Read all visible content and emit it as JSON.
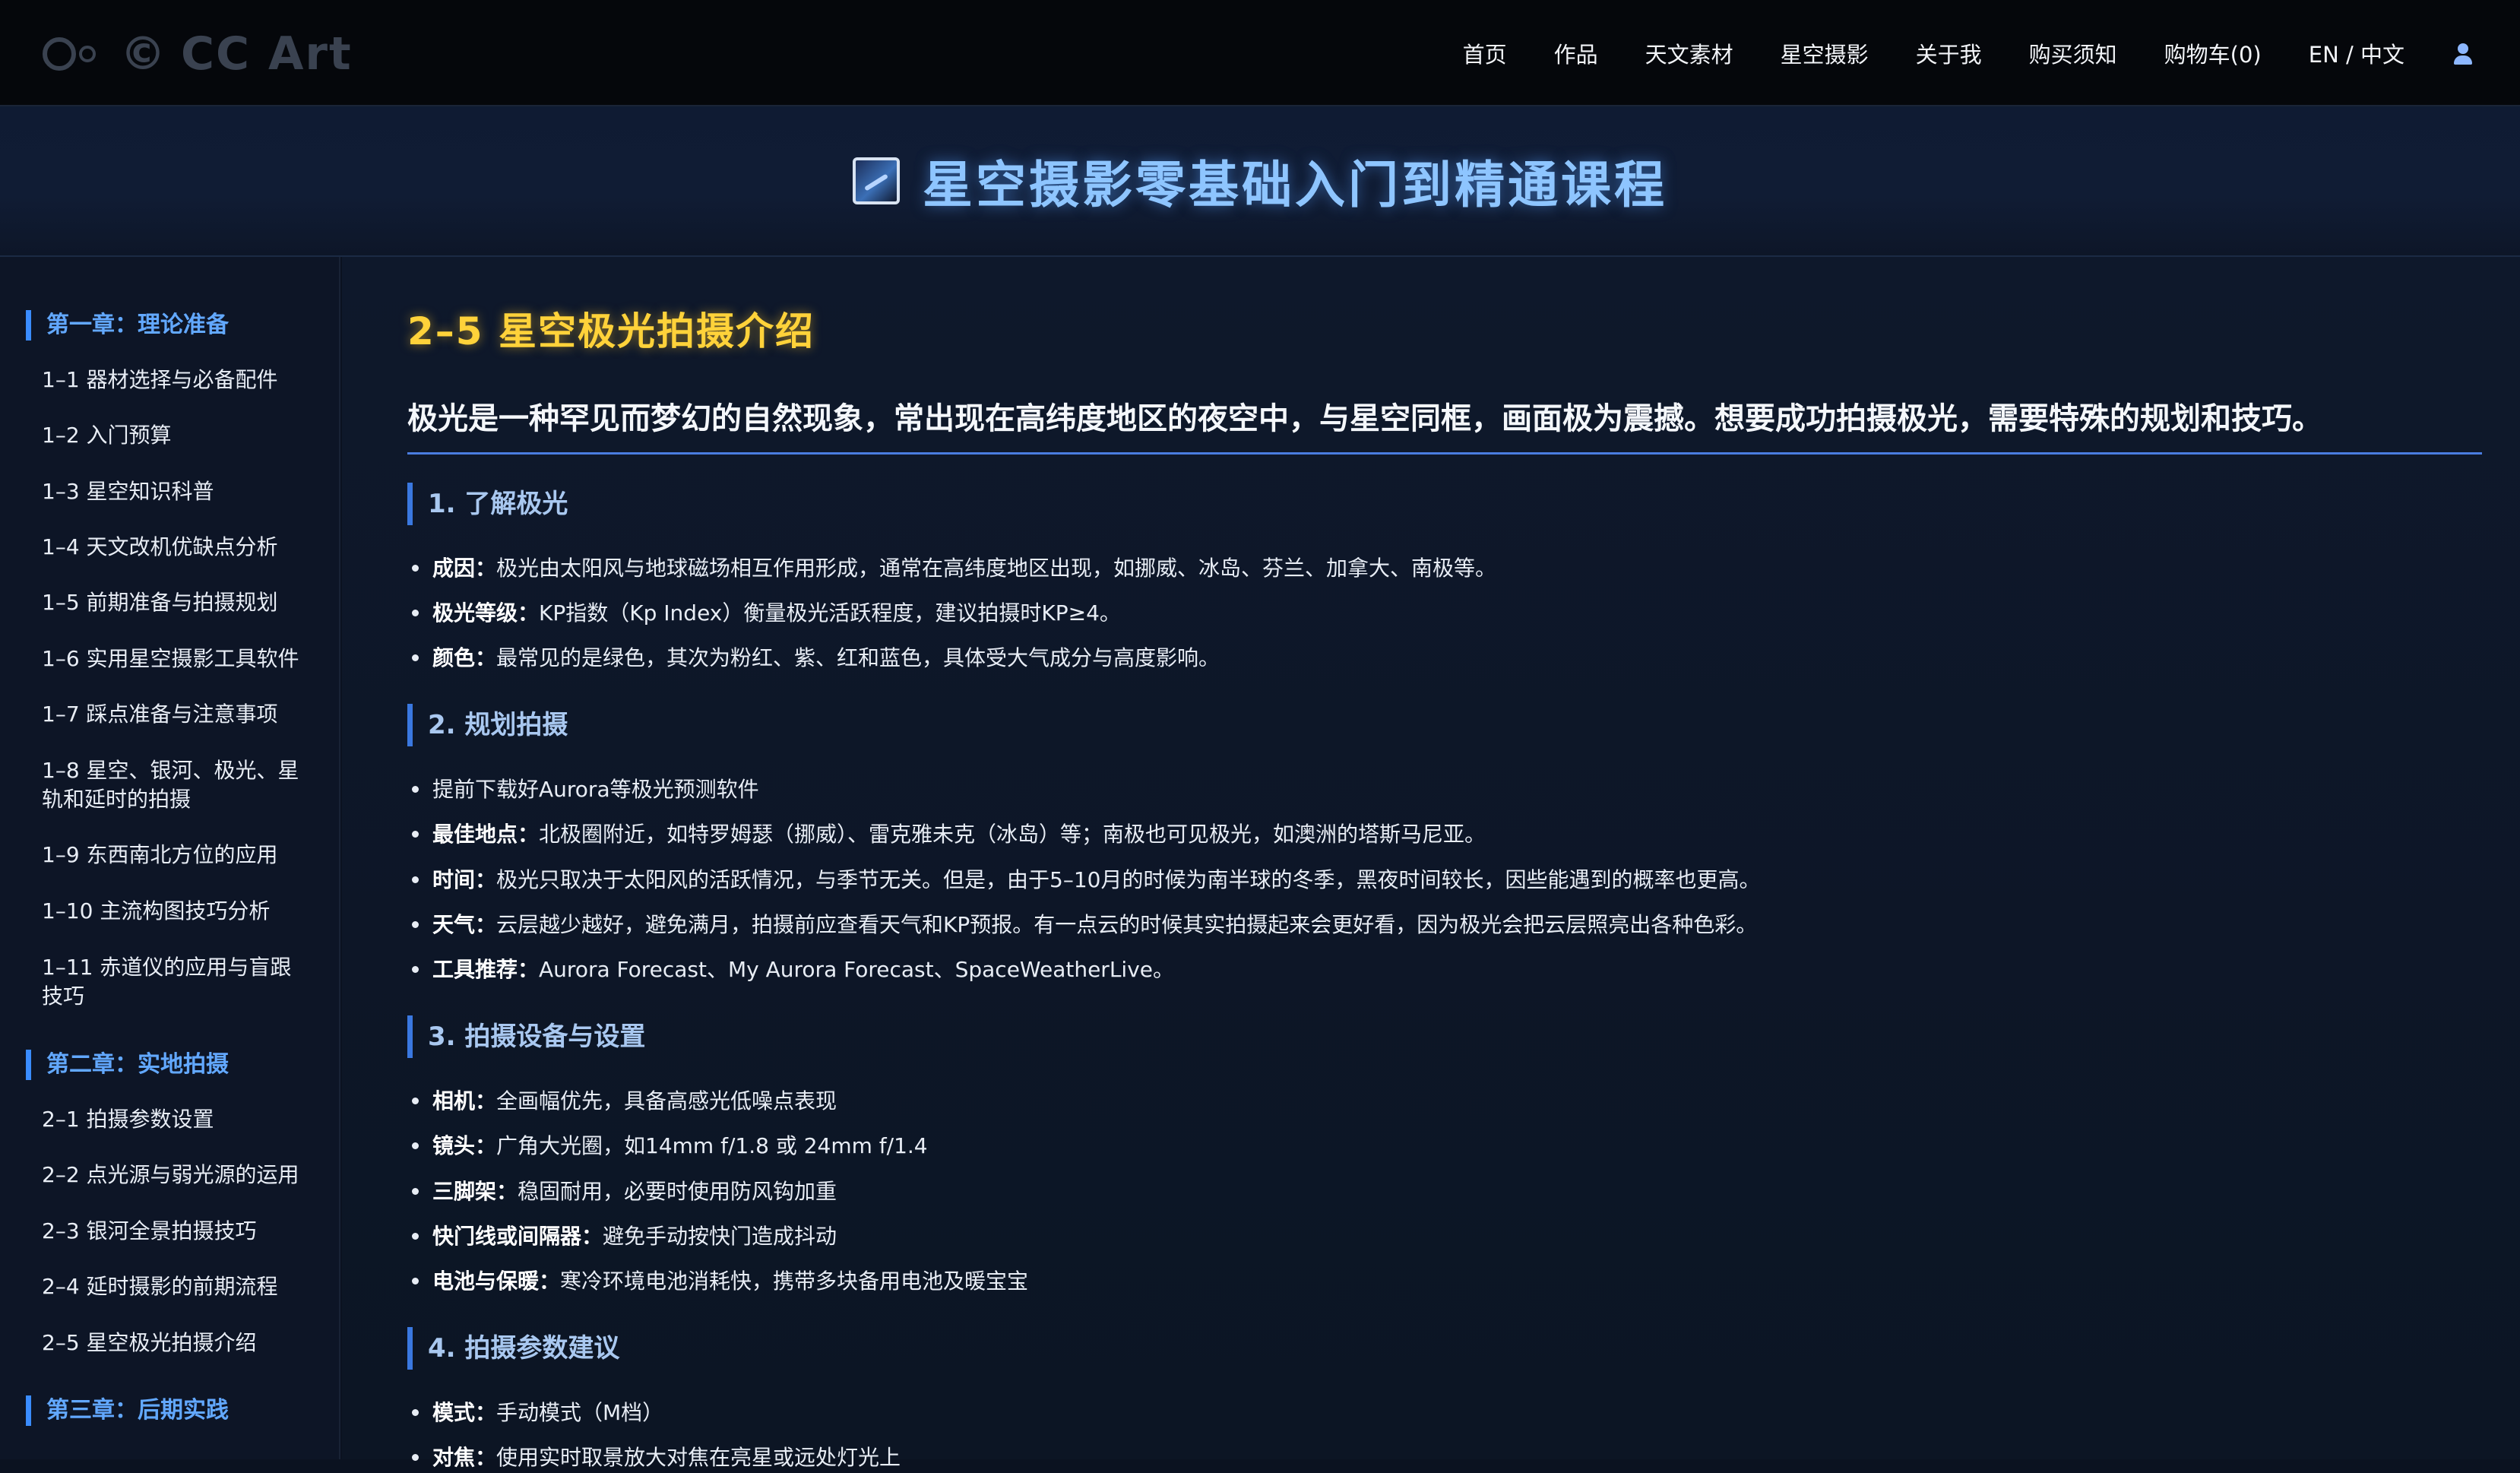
{
  "brand": {
    "copyright": "©",
    "name": "CC Art"
  },
  "nav": [
    "首页",
    "作品",
    "天文素材",
    "星空摄影",
    "关于我",
    "购买须知",
    "购物车(0)",
    "EN / 中文"
  ],
  "banner": {
    "title": "星空摄影零基础入门到精通课程"
  },
  "sidebar": {
    "chapter1": "第一章：理论准备",
    "items1": [
      "1–1 器材选择与必备配件",
      "1–2 入门预算",
      "1–3 星空知识科普",
      "1–4 天文改机优缺点分析",
      "1–5 前期准备与拍摄规划",
      "1–6 实用星空摄影工具软件",
      "1–7 踩点准备与注意事项",
      "1–8 星空、银河、极光、星轨和延时的拍摄",
      "1–9 东西南北方位的应用",
      "1–10 主流构图技巧分析",
      "1–11 赤道仪的应用与盲跟技巧"
    ],
    "chapter2": "第二章：实地拍摄",
    "items2": [
      "2–1 拍摄参数设置",
      "2–2 点光源与弱光源的运用",
      "2–3 银河全景拍摄技巧",
      "2–4 延时摄影的前期流程",
      "2–5 星空极光拍摄介绍"
    ],
    "chapter3": "第三章：后期实践"
  },
  "main": {
    "title": "2–5 星空极光拍摄介绍",
    "intro": "极光是一种罕见而梦幻的自然现象，常出现在高纬度地区的夜空中，与星空同框，画面极为震撼。想要成功拍摄极光，需要特殊的规划和技巧。",
    "s1": {
      "heading": "1. 了解极光",
      "b1k": "成因：",
      "b1": "极光由太阳风与地球磁场相互作用形成，通常在高纬度地区出现，如挪威、冰岛、芬兰、加拿大、南极等。",
      "b2k": "极光等级：",
      "b2": "KP指数（Kp Index）衡量极光活跃程度，建议拍摄时KP≥4。",
      "b3k": "颜色：",
      "b3": "最常见的是绿色，其次为粉红、紫、红和蓝色，具体受大气成分与高度影响。"
    },
    "s2": {
      "heading": "2. 规划拍摄",
      "b1": "提前下载好Aurora等极光预测软件",
      "b2k": "最佳地点：",
      "b2": "北极圈附近，如特罗姆瑟（挪威）、雷克雅未克（冰岛）等；南极也可见极光，如澳洲的塔斯马尼亚。",
      "b3k": "时间：",
      "b3": "极光只取决于太阳风的活跃情况，与季节无关。但是，由于5–10月的时候为南半球的冬季，黑夜时间较长，因些能遇到的概率也更高。",
      "b4k": "天气：",
      "b4": "云层越少越好，避免满月，拍摄前应查看天气和KP预报。有一点云的时候其实拍摄起来会更好看，因为极光会把云层照亮出各种色彩。",
      "b5k": "工具推荐：",
      "b5": "Aurora Forecast、My Aurora Forecast、SpaceWeatherLive。"
    },
    "s3": {
      "heading": "3. 拍摄设备与设置",
      "b1k": "相机：",
      "b1": "全画幅优先，具备高感光低噪点表现",
      "b2k": "镜头：",
      "b2": "广角大光圈，如14mm f/1.8 或 24mm f/1.4",
      "b3k": "三脚架：",
      "b3": "稳固耐用，必要时使用防风钩加重",
      "b4k": "快门线或间隔器：",
      "b4": "避免手动按快门造成抖动",
      "b5k": "电池与保暖：",
      "b5": "寒冷环境电池消耗快，携带多块备用电池及暖宝宝"
    },
    "s4": {
      "heading": "4. 拍摄参数建议",
      "b1k": "模式：",
      "b1": "手动模式（M档）",
      "b2k": "对焦：",
      "b2": "使用实时取景放大对焦在亮星或远处灯光上"
    }
  }
}
